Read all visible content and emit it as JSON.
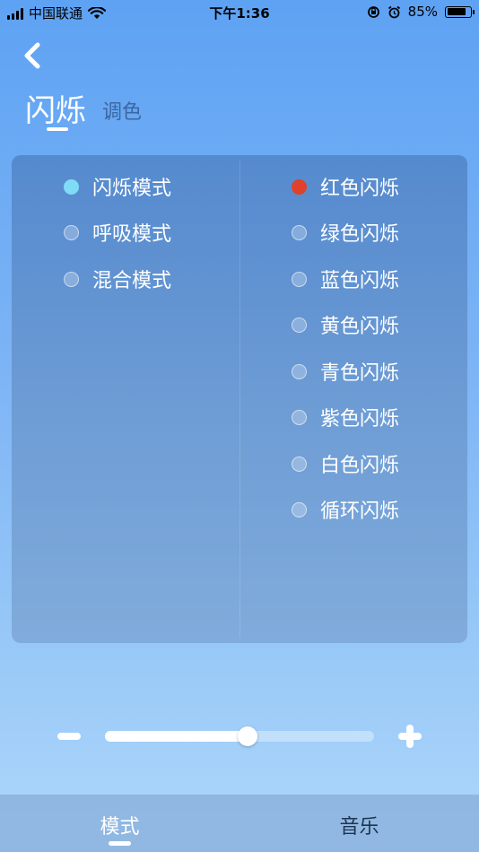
{
  "status_bar": {
    "carrier": "中国联通",
    "time": "下午1:36",
    "battery_percent_label": "85%",
    "battery_level": 0.85,
    "icons": [
      "signal-icon",
      "wifi-icon",
      "rotation-lock-icon",
      "alarm-icon",
      "battery-icon"
    ]
  },
  "nav": {
    "back_icon": "chevron-left-icon"
  },
  "header": {
    "tabs": [
      {
        "label": "闪烁",
        "active": true
      },
      {
        "label": "调色",
        "active": false
      }
    ]
  },
  "modes": {
    "items": [
      {
        "label": "闪烁模式",
        "selected": true,
        "color": "#7fdcf6"
      },
      {
        "label": "呼吸模式",
        "selected": false
      },
      {
        "label": "混合模式",
        "selected": false
      }
    ]
  },
  "colors": {
    "items": [
      {
        "label": "红色闪烁",
        "selected": true,
        "color": "#e0412a"
      },
      {
        "label": "绿色闪烁",
        "selected": false
      },
      {
        "label": "蓝色闪烁",
        "selected": false
      },
      {
        "label": "黄色闪烁",
        "selected": false
      },
      {
        "label": "青色闪烁",
        "selected": false
      },
      {
        "label": "紫色闪烁",
        "selected": false
      },
      {
        "label": "白色闪烁",
        "selected": false
      },
      {
        "label": "循环闪烁",
        "selected": false
      }
    ]
  },
  "slider": {
    "value": 0.53,
    "minus_icon": "minus-icon",
    "plus_icon": "plus-icon"
  },
  "tab_bar": {
    "tabs": [
      {
        "label": "模式",
        "active": true
      },
      {
        "label": "音乐",
        "active": false
      }
    ]
  },
  "theme": {
    "accent": "#ffffff",
    "inactive_header_tab": "#3c67a3",
    "inactive_bottom_tab": "#1e3350"
  }
}
